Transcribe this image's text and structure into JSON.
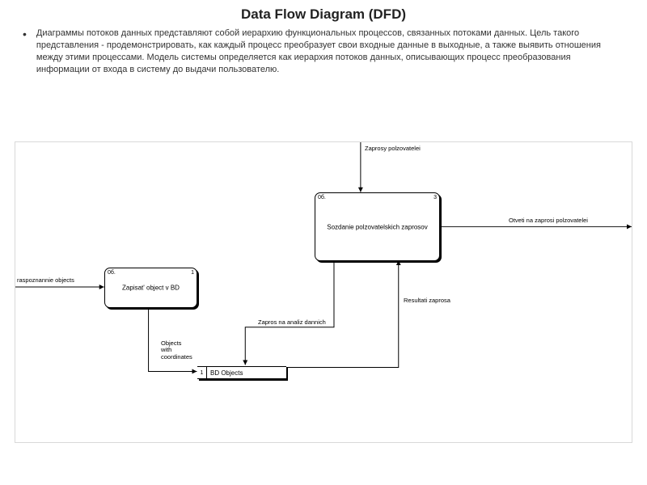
{
  "title": "Data Flow Diagram (DFD)",
  "description": "Диаграммы потоков данных представляют собой иерархию функциональных процессов, связанных потоками данных. Цель такого представления - продемонстрировать, как каждый процесс преобразует свои входные данные в выходные, а также выявить отношения между этими процессами. Модель системы определяется как иерархия потоков данных, описывающих процесс преобразования информации от входа в систему до выдачи пользователю.",
  "nodes": {
    "p1": {
      "idleft": "0б.",
      "idright": "1",
      "label": "Zapisat' object v BD"
    },
    "p3": {
      "idleft": "0б.",
      "idright": "3",
      "label": "Sozdanie polzovatelskich zaprosov"
    }
  },
  "store": {
    "id": "1",
    "label": "BD Objects"
  },
  "flows": {
    "f_in_left": "raspoznannie objects",
    "f_in_top": "Zaprosy polzovatelei",
    "f_out_right": "Otveti na zaprosi polzovatelei",
    "f_p3_store": "Zapros na analiz dannich",
    "f_store_p3": "Resultati zaprosa",
    "f_p1_store": "Objects\nwith\ncoordinates"
  }
}
